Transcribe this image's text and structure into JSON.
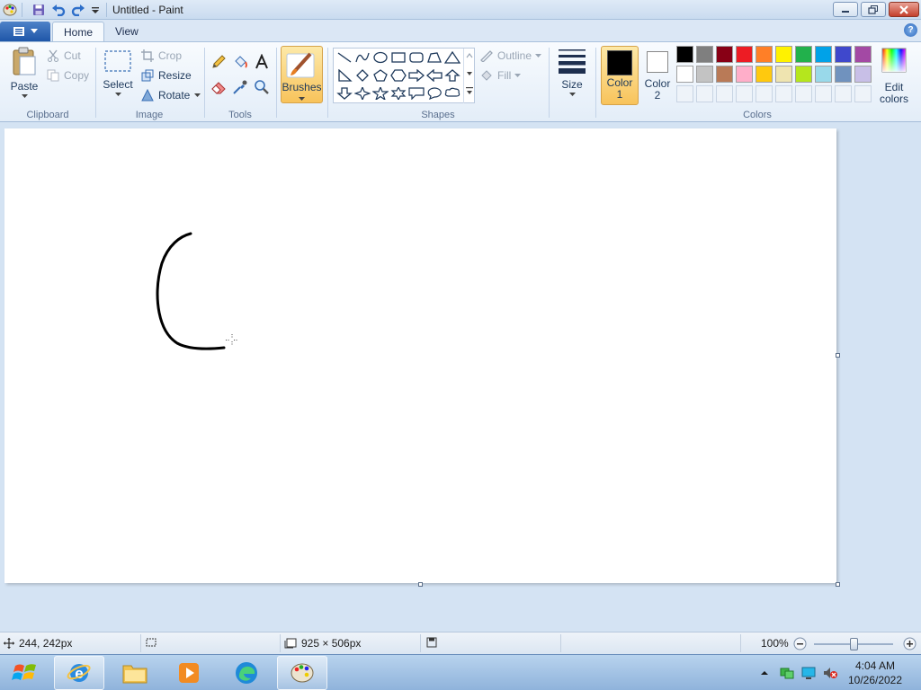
{
  "window": {
    "title": "Untitled - Paint"
  },
  "tabs": [
    {
      "label": "Home"
    },
    {
      "label": "View"
    }
  ],
  "clipboard": {
    "paste": "Paste",
    "cut": "Cut",
    "copy": "Copy",
    "group": "Clipboard"
  },
  "image": {
    "select": "Select",
    "crop": "Crop",
    "resize": "Resize",
    "rotate": "Rotate",
    "group": "Image"
  },
  "tools": {
    "group": "Tools"
  },
  "brushes": {
    "label": "Brushes"
  },
  "shapes": {
    "outline": "Outline",
    "fill": "Fill",
    "group": "Shapes"
  },
  "size": {
    "label": "Size"
  },
  "colors": {
    "color1_line1": "Color",
    "color1_line2": "1",
    "color2_line1": "Color",
    "color2_line2": "2",
    "edit_line1": "Edit",
    "edit_line2": "colors",
    "group": "Colors",
    "color1": "#000000",
    "color2": "#ffffff",
    "row1": [
      "#000000",
      "#7f7f7f",
      "#880015",
      "#ed1c24",
      "#ff7f27",
      "#fff200",
      "#22b14c",
      "#00a2e8",
      "#3f48cc",
      "#a349a4"
    ],
    "row2": [
      "#ffffff",
      "#c3c3c3",
      "#b97a57",
      "#ffaec9",
      "#ffc90e",
      "#efe4b0",
      "#b5e61d",
      "#99d9ea",
      "#7092be",
      "#c8bfe7"
    ]
  },
  "status": {
    "cursor_pos": "244, 242px",
    "canvas_size": "925 × 506px",
    "zoom": "100%",
    "zoom_level": 0.5
  },
  "taskbar": {
    "time": "4:04 AM",
    "date": "10/26/2022"
  }
}
